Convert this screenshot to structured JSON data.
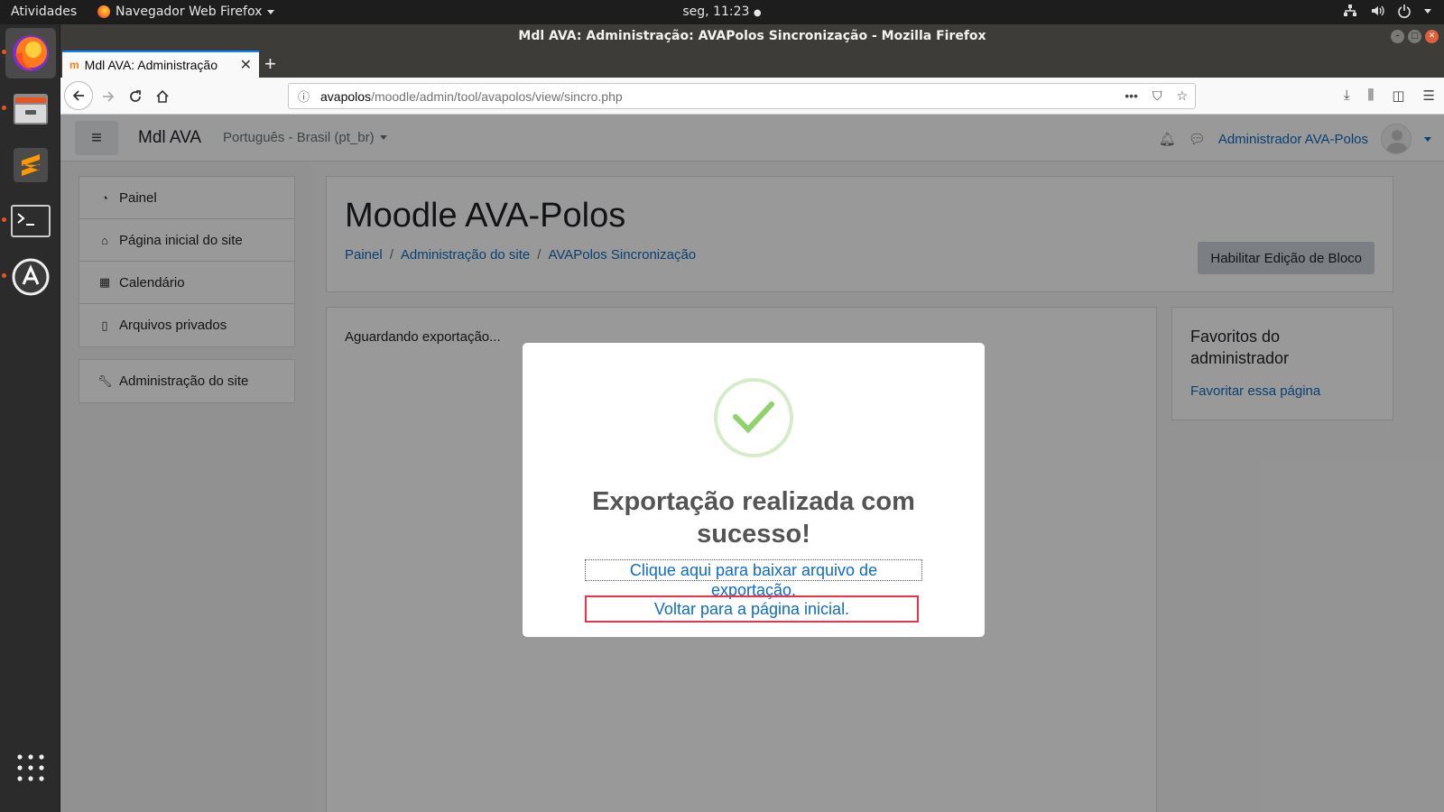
{
  "os_topbar": {
    "activities": "Atividades",
    "app_menu": "Navegador Web Firefox",
    "clock": "seg, 11:23"
  },
  "dock": {
    "apps": [
      "firefox-icon",
      "files-icon",
      "sublime-text-icon",
      "terminal-icon",
      "software-updater-icon"
    ],
    "show_apps": "grid-icon"
  },
  "browser": {
    "window_title": "Mdl AVA: Administração: AVAPolos Sincronização - Mozilla Firefox",
    "tab_title": "Mdl AVA: Administração",
    "url_host": "avapolos",
    "url_path": "/moodle/admin/tool/avapolos/view/sincro.php"
  },
  "moodle": {
    "brand": "Mdl AVA",
    "language": "Português - Brasil (pt_br)",
    "user_name": "Administrador AVA-Polos",
    "nav": [
      {
        "label": "Painel",
        "icon": "dashboard-icon"
      },
      {
        "label": "Página inicial do site",
        "icon": "home-icon"
      },
      {
        "label": "Calendário",
        "icon": "calendar-icon"
      },
      {
        "label": "Arquivos privados",
        "icon": "file-icon"
      }
    ],
    "admin_nav": {
      "label": "Administração do site",
      "icon": "wrench-icon"
    },
    "page_title": "Moodle AVA-Polos",
    "breadcrumb": [
      "Painel",
      "Administração do site",
      "AVAPolos Sincronização"
    ],
    "edit_button": "Habilitar Edição de Bloco",
    "status_text": "Aguardando exportação...",
    "favorites": {
      "title": "Favoritos do administrador",
      "link": "Favoritar essa página"
    }
  },
  "modal": {
    "title": "Exportação realizada com sucesso!",
    "download_link": "Clique aqui para baixar arquivo de exportação.",
    "home_link": "Voltar para a página inicial.",
    "success_color": "#8fd16b"
  }
}
